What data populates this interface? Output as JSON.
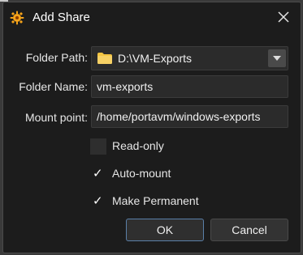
{
  "dialog": {
    "title": "Add Share",
    "app_icon": "virtualbox-icon",
    "close_icon": "close-icon"
  },
  "fields": {
    "folder_path": {
      "label": "Folder Path:",
      "value": "D:\\VM-Exports",
      "icon": "folder-icon"
    },
    "folder_name": {
      "label": "Folder Name:",
      "value": "vm-exports"
    },
    "mount_point": {
      "label": "Mount point:",
      "value": "/home/portavm/windows-exports"
    }
  },
  "options": {
    "read_only": {
      "label": "Read-only",
      "checked": false
    },
    "auto_mount": {
      "label": "Auto-mount",
      "checked": true
    },
    "make_permanent": {
      "label": "Make Permanent",
      "checked": true
    }
  },
  "buttons": {
    "ok": "OK",
    "cancel": "Cancel"
  },
  "colors": {
    "background": "#1c1c1c",
    "field": "#2b2b2b",
    "accent_border": "#5a7fa8",
    "folder": "#f4c542",
    "icon_orange": "#f5a31a"
  }
}
